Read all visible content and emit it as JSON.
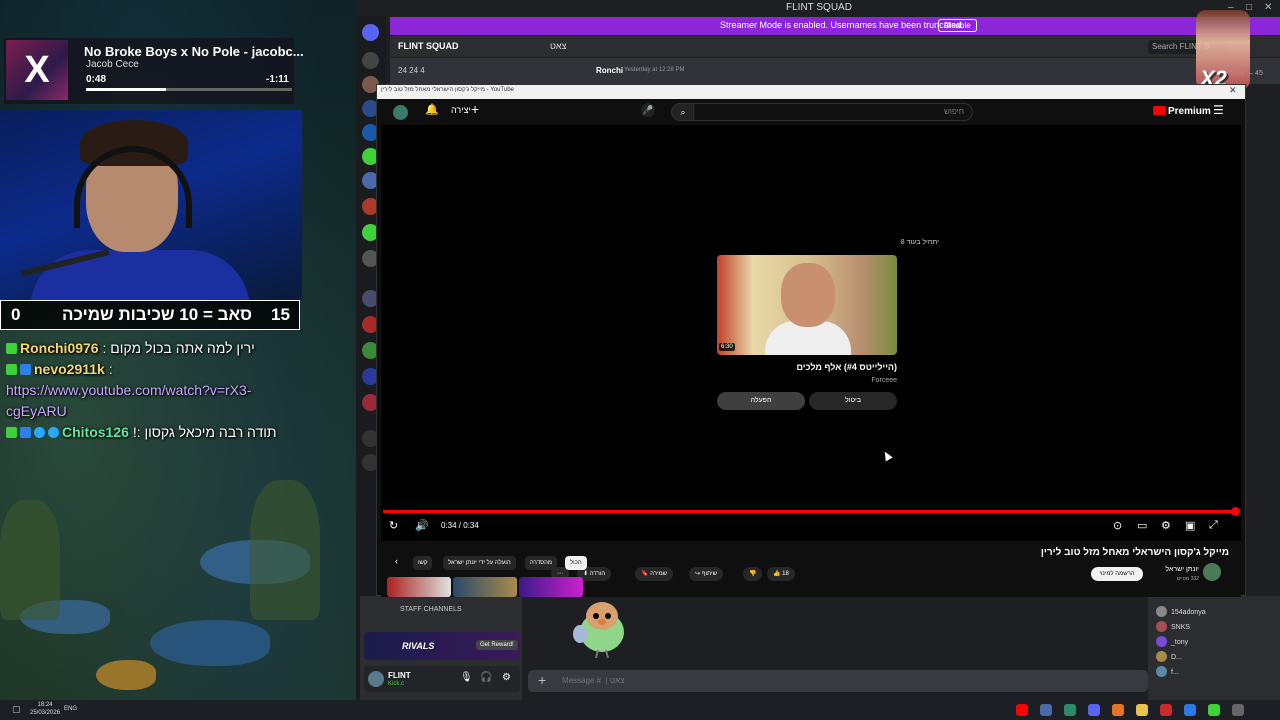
{
  "now_playing": {
    "title": "No Broke Boys x No Pole - jacobc...",
    "artist": "Jacob Cece",
    "elapsed": "0:48",
    "remaining": "-1:11",
    "progress_fraction": 0.39
  },
  "counter": {
    "left_value": "0",
    "label": "סאב = 10 שכיבות שמיכה",
    "right_value": "15"
  },
  "stream_chat": [
    {
      "badges": [
        "k"
      ],
      "nick": "Ronchi0976",
      "nick_color": "#f5d76e",
      "text": "ירין למה אתה בכול מקום :"
    },
    {
      "badges": [
        "k",
        "x"
      ],
      "nick": "nevo2911k",
      "nick_color": "#f5d76e",
      "text": ":"
    },
    {
      "badges": [],
      "nick": "",
      "nick_color": "#c9a4ff",
      "text": "https://www.youtube.com/watch?v=rX3-cgEyARU",
      "is_link": true
    },
    {
      "badges": [
        "k",
        "x",
        "c",
        "c"
      ],
      "nick": "Chitos126",
      "nick_color": "#5ee6a8",
      "text": "תודה רבה מיכאל גקסון :!"
    }
  ],
  "discord": {
    "window_title": "FLINT SQUAD",
    "banner_text": "Streamer Mode is enabled. Usernames have been truncated.",
    "banner_button": "Disable",
    "server_name": "FLINT SQUAD",
    "channel_name": "צאט",
    "search_placeholder": "Search FLINT S",
    "voice_counts": "24   24   4",
    "msg_author": "Ronchi",
    "msg_time": "Yesterday at 12:28 PM",
    "activity_label": "Activity — 45",
    "staff_channels": "STAFF CHANNELS",
    "rivals_label": "RIVALS",
    "reward_button": "Get Reward!",
    "user_name": "FLINT",
    "user_status": "Kick.c",
    "composer_placeholder": "Message #  | צאט",
    "members": [
      {
        "name": "154adonya"
      },
      {
        "name": "SNKS"
      },
      {
        "name": "_tony"
      },
      {
        "name": "D..."
      },
      {
        "name": "f..."
      }
    ]
  },
  "youtube": {
    "popup_title": "מייקל ג'קסון הישראלי מאחל מזל טוב לירין - YouTube",
    "create_label": "יצירה",
    "search_placeholder": "חיפוש",
    "logo_text": "Premium",
    "up_next_label": "יתחיל בעוד 8",
    "next_video_title": "(היילייטס #4) אלף מלכים",
    "next_video_channel": "Forceee",
    "next_video_duration": "6:30",
    "play_button": "הפעלה",
    "cancel_button": "ביטול",
    "time_display": "0:34 / 0:34",
    "progress_fraction": 1.0,
    "video_title": "מייקל ג'קסון הישראלי מאחל מזל טוב לירין",
    "channel_name": "יונתן ישראל",
    "channel_subs": "332 מנויים",
    "subscribe_button": "הרשמה למינוי",
    "likes": "18",
    "share_label": "שיתוף",
    "save_label": "שמירה",
    "download_label": "הורדה",
    "chips": [
      "הכול",
      "מהסדרה",
      "הועלה על ידי יונתן ישראל",
      "קשו"
    ]
  },
  "taskbar": {
    "time": "18:24",
    "date": "25/03/2026",
    "lang": "ENG"
  },
  "sticker_text": "X2",
  "colors": {
    "discord_banner": "#8c26d8",
    "youtube_red": "#ff0000",
    "kick_green": "#3fd13a"
  }
}
